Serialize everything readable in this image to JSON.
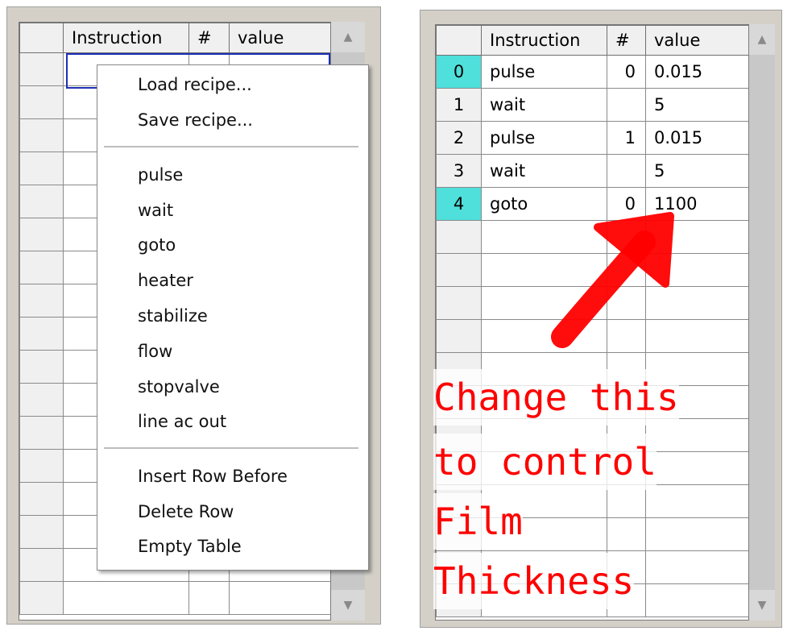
{
  "left_panel": {
    "headers": {
      "instruction": "Instruction",
      "number": "#",
      "value": "value"
    },
    "scroll_up": "▲",
    "scroll_down": "▼"
  },
  "context_menu": {
    "file_items": [
      "Load recipe...",
      "Save recipe..."
    ],
    "instruction_items": [
      "pulse",
      "wait",
      "goto",
      "heater",
      "stabilize",
      "flow",
      "stopvalve",
      "line ac out"
    ],
    "table_items": [
      "Insert Row Before",
      "Delete Row",
      "Empty Table"
    ]
  },
  "right_panel": {
    "headers": {
      "instruction": "Instruction",
      "number": "#",
      "value": "value"
    },
    "rows": [
      {
        "index": "0",
        "instruction": "pulse",
        "number": "0",
        "value": "0.015",
        "selected": true
      },
      {
        "index": "1",
        "instruction": "wait",
        "number": "",
        "value": "5",
        "selected": false
      },
      {
        "index": "2",
        "instruction": "pulse",
        "number": "1",
        "value": "0.015",
        "selected": false
      },
      {
        "index": "3",
        "instruction": "wait",
        "number": "",
        "value": "5",
        "selected": false
      },
      {
        "index": "4",
        "instruction": "goto",
        "number": "0",
        "value": "1100",
        "selected": true
      }
    ],
    "scroll_up": "▲",
    "scroll_down": "▼"
  },
  "annotation": {
    "lines": [
      "Change this",
      "to control",
      "Film",
      "Thickness"
    ],
    "color": "#ff0000"
  }
}
